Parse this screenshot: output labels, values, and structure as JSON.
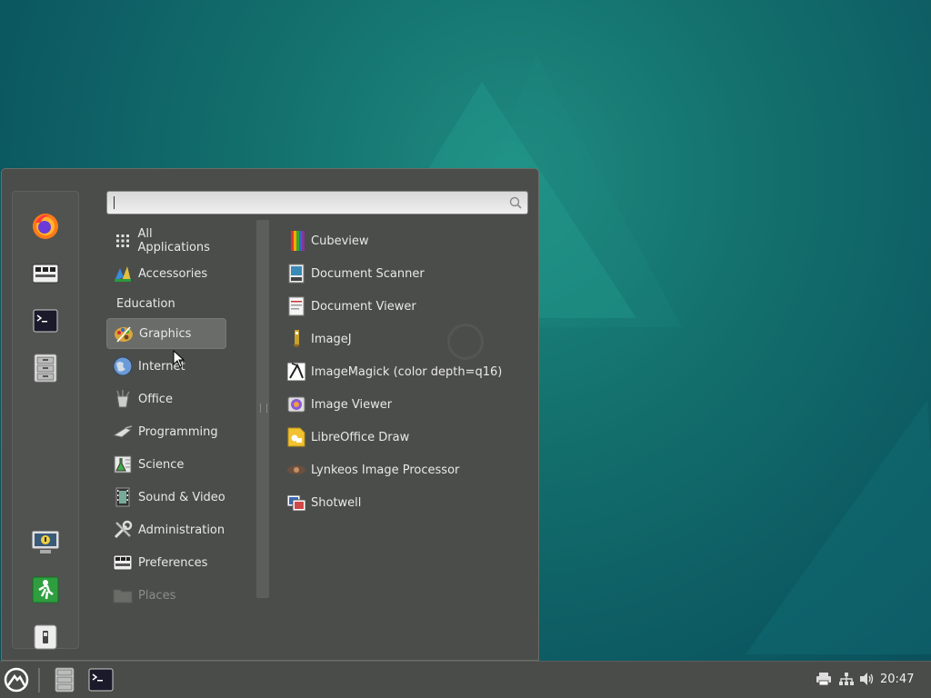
{
  "favorites": [
    {
      "name": "firefox-icon",
      "label": "Firefox"
    },
    {
      "name": "settings-icon",
      "label": "System Settings"
    },
    {
      "name": "terminal-icon",
      "label": "Terminal"
    },
    {
      "name": "files-icon",
      "label": "Files"
    }
  ],
  "session_buttons": [
    {
      "name": "lock-screen-icon"
    },
    {
      "name": "logout-icon"
    },
    {
      "name": "shutdown-icon"
    }
  ],
  "search": {
    "value": "",
    "placeholder": ""
  },
  "categories": [
    {
      "label": "All Applications",
      "icon": "grid-icon"
    },
    {
      "label": "Accessories",
      "icon": "accessories-icon"
    },
    {
      "label": "Education",
      "icon": ""
    },
    {
      "label": "Graphics",
      "icon": "graphics-icon",
      "selected": true
    },
    {
      "label": "Internet",
      "icon": "internet-icon"
    },
    {
      "label": "Office",
      "icon": "office-icon"
    },
    {
      "label": "Programming",
      "icon": "programming-icon"
    },
    {
      "label": "Science",
      "icon": "science-icon"
    },
    {
      "label": "Sound & Video",
      "icon": "sound-video-icon"
    },
    {
      "label": "Administration",
      "icon": "administration-icon"
    },
    {
      "label": "Preferences",
      "icon": "preferences-icon"
    },
    {
      "label": "Places",
      "icon": "folder-icon",
      "dim": true
    }
  ],
  "apps": [
    {
      "label": "Cubeview",
      "icon": "cubeview-icon"
    },
    {
      "label": "Document Scanner",
      "icon": "scanner-icon"
    },
    {
      "label": "Document Viewer",
      "icon": "document-viewer-icon"
    },
    {
      "label": "ImageJ",
      "icon": "imagej-icon"
    },
    {
      "label": "ImageMagick (color depth=q16)",
      "icon": "imagemagick-icon"
    },
    {
      "label": "Image Viewer",
      "icon": "image-viewer-icon"
    },
    {
      "label": "LibreOffice Draw",
      "icon": "libreoffice-draw-icon"
    },
    {
      "label": "Lynkeos Image Processor",
      "icon": "lynkeos-icon"
    },
    {
      "label": "Shotwell",
      "icon": "shotwell-icon"
    }
  ],
  "taskbar": {
    "items": [
      "menu-icon",
      "files-icon",
      "terminal-icon"
    ],
    "tray": [
      "printer-icon",
      "network-icon",
      "volume-icon"
    ],
    "clock": "20:47"
  },
  "colors": {
    "accent": "#6a6c69",
    "panel": "#4b4d4a",
    "taskbar": "#4a4c49"
  }
}
